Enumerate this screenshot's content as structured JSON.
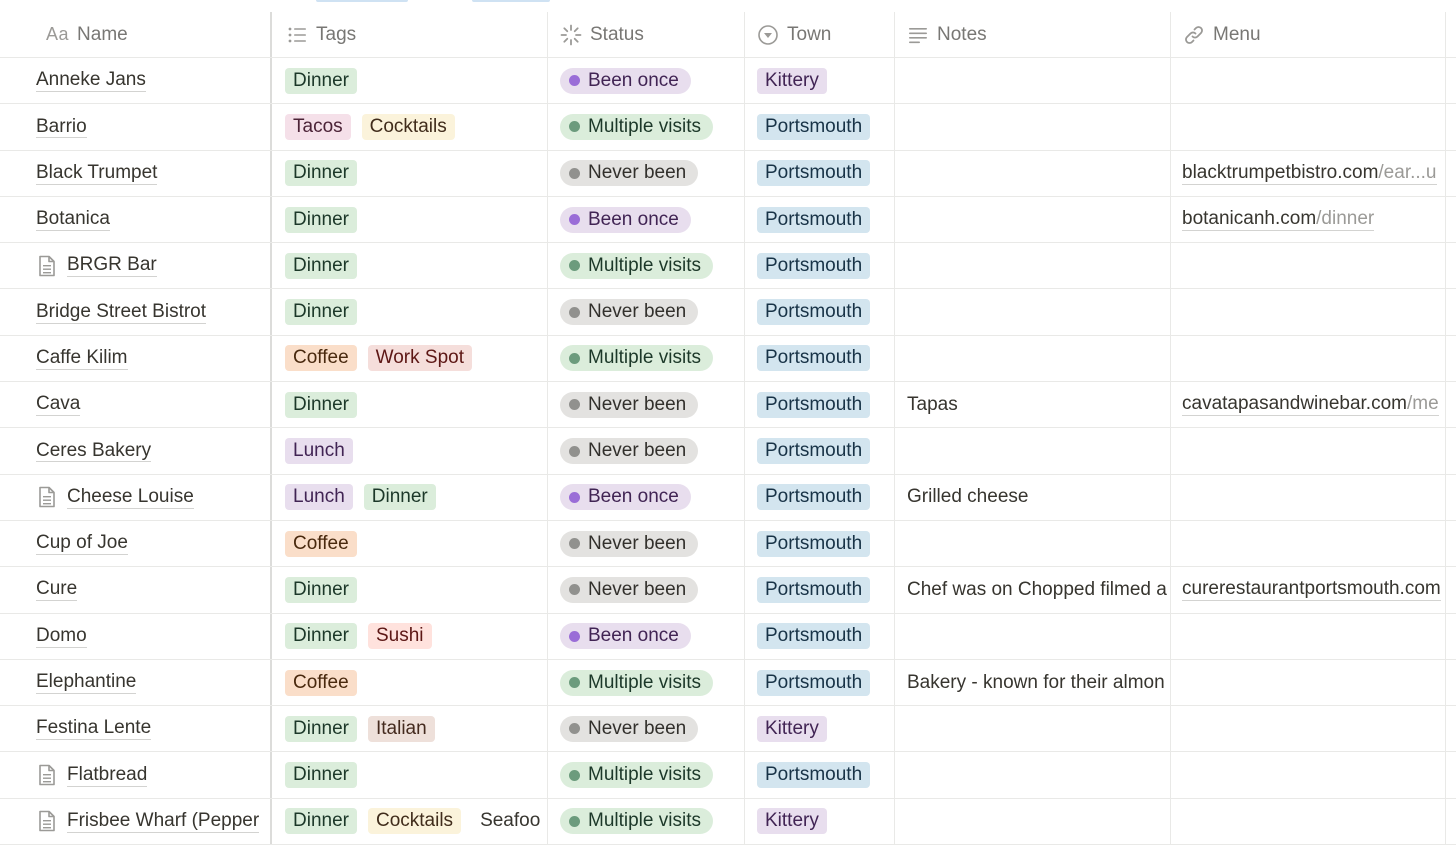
{
  "columns": {
    "name": "Name",
    "name_prefix": "Aa",
    "tags": "Tags",
    "status": "Status",
    "town": "Town",
    "notes": "Notes",
    "menu": "Menu"
  },
  "colors": {
    "Dinner": {
      "bg": "#dbeddb",
      "fg": "#1c3829"
    },
    "Tacos": {
      "bg": "#f5e0e9",
      "fg": "#4c2337"
    },
    "Cocktails": {
      "bg": "#fbf3db",
      "fg": "#402c1b"
    },
    "Coffee": {
      "bg": "#fadec9",
      "fg": "#49290e"
    },
    "Work Spot": {
      "bg": "#f5dedb",
      "fg": "#5d1715"
    },
    "Lunch": {
      "bg": "#e8deee",
      "fg": "#412454"
    },
    "Sushi": {
      "bg": "#ffe2dd",
      "fg": "#5d1715"
    },
    "Italian": {
      "bg": "#eee0da",
      "fg": "#442a1e"
    },
    "Seafood": {
      "bg": "#fadec9",
      "fg": "#49290e"
    },
    "Been once": {
      "bg": "#e8deee",
      "fg": "#412454",
      "dot": "#9a6dd7"
    },
    "Multiple visits": {
      "bg": "#dbeddb",
      "fg": "#1c3829",
      "dot": "#6c9b7d"
    },
    "Never been": {
      "bg": "#e3e2e0",
      "fg": "#32302c",
      "dot": "#91918e"
    },
    "Kittery": {
      "bg": "#e8deee",
      "fg": "#412454"
    },
    "Portsmouth": {
      "bg": "#d3e5ef",
      "fg": "#183347"
    }
  },
  "rows": [
    {
      "name": "Anneke Jans",
      "page_icon": false,
      "tags": [
        "Dinner"
      ],
      "status": "Been once",
      "town": "Kittery",
      "notes": "",
      "menu_domain": "",
      "menu_path": ""
    },
    {
      "name": "Barrio",
      "page_icon": false,
      "tags": [
        "Tacos",
        "Cocktails"
      ],
      "status": "Multiple visits",
      "town": "Portsmouth",
      "notes": "",
      "menu_domain": "",
      "menu_path": ""
    },
    {
      "name": "Black Trumpet",
      "page_icon": false,
      "tags": [
        "Dinner"
      ],
      "status": "Never been",
      "town": "Portsmouth",
      "notes": "",
      "menu_domain": "blacktrumpetbistro.com",
      "menu_path": "/ear...u"
    },
    {
      "name": "Botanica",
      "page_icon": false,
      "tags": [
        "Dinner"
      ],
      "status": "Been once",
      "town": "Portsmouth",
      "notes": "",
      "menu_domain": "botanicanh.com",
      "menu_path": "/dinner"
    },
    {
      "name": "BRGR Bar",
      "page_icon": true,
      "tags": [
        "Dinner"
      ],
      "status": "Multiple visits",
      "town": "Portsmouth",
      "notes": "",
      "menu_domain": "",
      "menu_path": ""
    },
    {
      "name": "Bridge Street Bistrot",
      "page_icon": false,
      "tags": [
        "Dinner"
      ],
      "status": "Never been",
      "town": "Portsmouth",
      "notes": "",
      "menu_domain": "",
      "menu_path": ""
    },
    {
      "name": "Caffe Kilim",
      "page_icon": false,
      "tags": [
        "Coffee",
        "Work Spot"
      ],
      "status": "Multiple visits",
      "town": "Portsmouth",
      "notes": "",
      "menu_domain": "",
      "menu_path": ""
    },
    {
      "name": "Cava",
      "page_icon": false,
      "tags": [
        "Dinner"
      ],
      "status": "Never been",
      "town": "Portsmouth",
      "notes": "Tapas",
      "menu_domain": "cavatapasandwinebar.com",
      "menu_path": "/me"
    },
    {
      "name": "Ceres Bakery",
      "page_icon": false,
      "tags": [
        "Lunch"
      ],
      "status": "Never been",
      "town": "Portsmouth",
      "notes": "",
      "menu_domain": "",
      "menu_path": ""
    },
    {
      "name": "Cheese Louise",
      "page_icon": true,
      "tags": [
        "Lunch",
        "Dinner"
      ],
      "status": "Been once",
      "town": "Portsmouth",
      "notes": "Grilled cheese",
      "menu_domain": "",
      "menu_path": ""
    },
    {
      "name": "Cup of Joe",
      "page_icon": false,
      "tags": [
        "Coffee"
      ],
      "status": "Never been",
      "town": "Portsmouth",
      "notes": "",
      "menu_domain": "",
      "menu_path": ""
    },
    {
      "name": "Cure",
      "page_icon": false,
      "tags": [
        "Dinner"
      ],
      "status": "Never been",
      "town": "Portsmouth",
      "notes": "Chef was on Chopped filmed a",
      "menu_domain": "curerestaurantportsmouth.com",
      "menu_path": ""
    },
    {
      "name": "Domo",
      "page_icon": false,
      "tags": [
        "Dinner",
        "Sushi"
      ],
      "status": "Been once",
      "town": "Portsmouth",
      "notes": "",
      "menu_domain": "",
      "menu_path": ""
    },
    {
      "name": "Elephantine",
      "page_icon": false,
      "tags": [
        "Coffee"
      ],
      "status": "Multiple visits",
      "town": "Portsmouth",
      "notes": "Bakery - known for their almon",
      "menu_domain": "",
      "menu_path": ""
    },
    {
      "name": "Festina Lente",
      "page_icon": false,
      "tags": [
        "Dinner",
        "Italian"
      ],
      "status": "Never been",
      "town": "Kittery",
      "notes": "",
      "menu_domain": "",
      "menu_path": ""
    },
    {
      "name": "Flatbread",
      "page_icon": true,
      "tags": [
        "Dinner"
      ],
      "status": "Multiple visits",
      "town": "Portsmouth",
      "notes": "",
      "menu_domain": "",
      "menu_path": ""
    },
    {
      "name": "Frisbee Wharf (Pepper",
      "page_icon": true,
      "tags": [
        "Dinner",
        "Cocktails",
        "Seafoo"
      ],
      "status": "Multiple visits",
      "town": "Kittery",
      "notes": "",
      "menu_domain": "",
      "menu_path": ""
    }
  ]
}
